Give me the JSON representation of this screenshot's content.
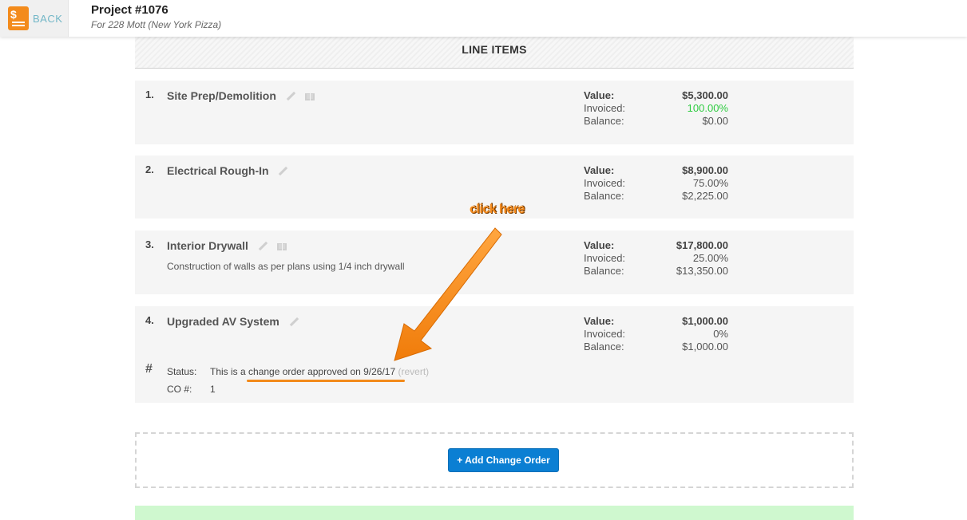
{
  "header": {
    "back_label": "BACK",
    "project_title": "Project #1076",
    "project_subtitle": "For 228 Mott (New York Pizza)"
  },
  "section_title": "LINE ITEMS",
  "labels": {
    "value": "Value:",
    "invoiced": "Invoiced:",
    "balance": "Balance:"
  },
  "items": [
    {
      "num": "1.",
      "name": "Site Prep/Demolition",
      "value": "$5,300.00",
      "invoiced": "100.00%",
      "balance": "$0.00"
    },
    {
      "num": "2.",
      "name": "Electrical Rough-In",
      "value": "$8,900.00",
      "invoiced": "75.00%",
      "balance": "$2,225.00"
    },
    {
      "num": "3.",
      "name": "Interior Drywall",
      "description": "Construction of walls as per plans using 1/4 inch drywall",
      "value": "$17,800.00",
      "invoiced": "25.00%",
      "balance": "$13,350.00"
    },
    {
      "num": "4.",
      "name": "Upgraded AV System",
      "value": "$1,000.00",
      "invoiced": "0%",
      "balance": "$1,000.00",
      "status_label": "Status:",
      "status_text_prefix": "This is a ",
      "status_link": "change order approved on 9/26/17",
      "revert_label": "(revert)",
      "co_label": "CO #:",
      "co_value": "1"
    }
  ],
  "add_change_order_label": "+ Add Change Order",
  "annotation": {
    "text": "click here",
    "color": "#f4891a"
  },
  "colors": {
    "accent_blue": "#0b7fd3",
    "invoiced_complete": "#2ecc40",
    "annotation_orange": "#f28a1a"
  }
}
